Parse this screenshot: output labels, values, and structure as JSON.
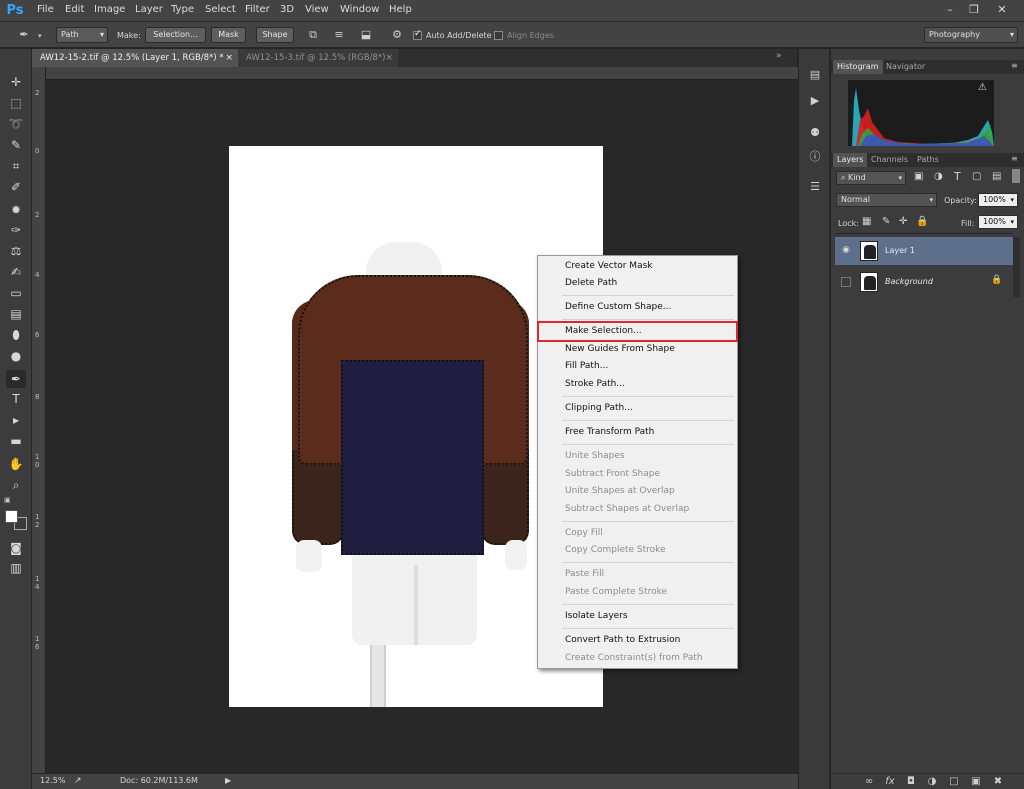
{
  "app": {
    "logo": "Ps"
  },
  "menu": [
    "File",
    "Edit",
    "Image",
    "Layer",
    "Type",
    "Select",
    "Filter",
    "3D",
    "View",
    "Window",
    "Help"
  ],
  "window_controls": {
    "minimize": "–",
    "restore": "❐",
    "close": "✕"
  },
  "options": {
    "mode": "Path",
    "make_label": "Make:",
    "selection": "Selection...",
    "mask": "Mask",
    "shape": "Shape",
    "auto_add_delete": "Auto Add/Delete",
    "align_edges": "Align Edges",
    "workspace": "Photography"
  },
  "tabs": [
    {
      "title": "AW12-15-2.tif @ 12.5% (Layer 1, RGB/8*) *",
      "close": "×"
    },
    {
      "title": "AW12-15-3.tif @ 12.5% (RGB/8*)",
      "close": "×"
    }
  ],
  "ruler_left": [
    "2",
    "0",
    "2",
    "4",
    "6",
    "8",
    "1\n0",
    "1\n2",
    "1\n4",
    "1\n6"
  ],
  "context_menu": [
    {
      "label": "Create Vector Mask",
      "disabled": false
    },
    {
      "label": "Delete Path",
      "disabled": false
    },
    {
      "label": "Define Custom Shape...",
      "disabled": false
    },
    {
      "label": "Make Selection...",
      "disabled": false
    },
    {
      "label": "New Guides From Shape",
      "disabled": false
    },
    {
      "label": "Fill Path...",
      "disabled": false
    },
    {
      "label": "Stroke Path...",
      "disabled": false
    },
    {
      "label": "Clipping Path...",
      "disabled": false
    },
    {
      "label": "Free Transform Path",
      "disabled": false
    },
    {
      "label": "Unite Shapes",
      "disabled": true
    },
    {
      "label": "Subtract Front Shape",
      "disabled": true
    },
    {
      "label": "Unite Shapes at Overlap",
      "disabled": true
    },
    {
      "label": "Subtract Shapes at Overlap",
      "disabled": true
    },
    {
      "label": "Copy Fill",
      "disabled": true
    },
    {
      "label": "Copy Complete Stroke",
      "disabled": true
    },
    {
      "label": "Paste Fill",
      "disabled": true
    },
    {
      "label": "Paste Complete Stroke",
      "disabled": true
    },
    {
      "label": "Isolate Layers",
      "disabled": false
    },
    {
      "label": "Convert Path to Extrusion",
      "disabled": false
    },
    {
      "label": "Create Constraint(s) from Path",
      "disabled": true
    }
  ],
  "status": {
    "zoom": "12.5%",
    "doc": "Doc: 60.2M/113.6M"
  },
  "panels": {
    "histogram_tabs": [
      "Histogram",
      "Navigator"
    ],
    "layers_tabs": [
      "Layers",
      "Channels",
      "Paths"
    ],
    "kind": "Kind",
    "blend": "Normal",
    "opacity_label": "Opacity:",
    "opacity": "100%",
    "lock_label": "Lock:",
    "fill_label": "Fill:",
    "fill": "100%",
    "layers": [
      {
        "name": "Layer 1",
        "selected": true
      },
      {
        "name": "Background",
        "selected": false
      }
    ]
  },
  "colors": {
    "highlight": "#e0262e",
    "selected_layer": "#5d6f8a"
  }
}
